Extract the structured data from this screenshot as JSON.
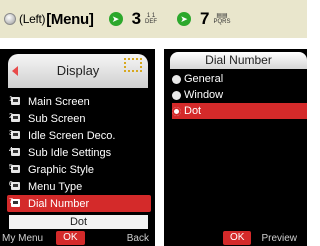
{
  "instruction": {
    "left_key": "(Left)",
    "menu_key": "[Menu]",
    "step1_number": "3",
    "step1_letters": "DEF",
    "step2_number": "7",
    "step2_letters": "PQRS"
  },
  "left_screen": {
    "title": "Display",
    "menu_items": [
      {
        "tag": "1",
        "label": "Main Screen"
      },
      {
        "tag": "2",
        "label": "Sub Screen"
      },
      {
        "tag": "3",
        "label": "Idle Screen Deco."
      },
      {
        "tag": "4",
        "label": "Sub Idle Settings"
      },
      {
        "tag": "5",
        "label": "Graphic Style"
      },
      {
        "tag": "6",
        "label": "Menu Type"
      },
      {
        "tag": "7",
        "label": "Dial Number"
      }
    ],
    "selected_index": 6,
    "current_value": "Dot",
    "softkeys": {
      "left": "My Menu",
      "center": "OK",
      "right": "Back"
    }
  },
  "right_screen": {
    "title": "Dial Number",
    "options": [
      "General",
      "Window",
      "Dot"
    ],
    "selected_index": 2,
    "softkeys": {
      "center": "OK",
      "right": "Preview"
    }
  },
  "colors": {
    "accent": "#d42a2a",
    "arrow": "#2ca82c",
    "instruction_bg": "#e9e6cc"
  }
}
